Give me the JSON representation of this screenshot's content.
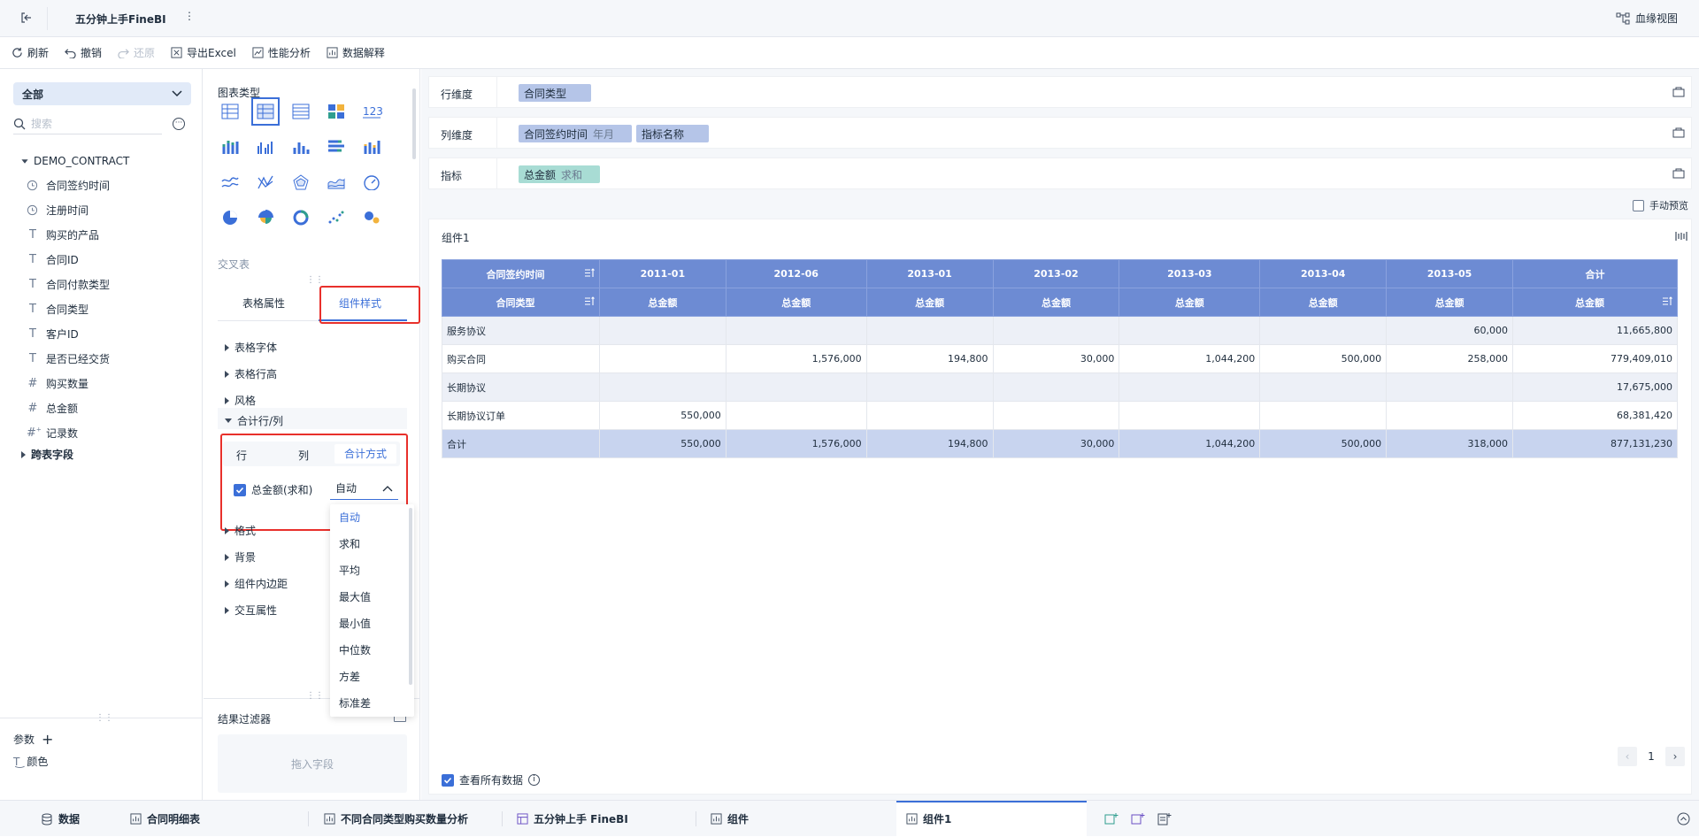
{
  "header": {
    "title": "五分钟上手FineBI",
    "lineage_view": "血缘视图"
  },
  "toolbar": {
    "refresh": "刷新",
    "undo": "撤销",
    "redo": "还原",
    "export_excel": "导出Excel",
    "perf_analysis": "性能分析",
    "data_explain": "数据解释"
  },
  "fields": {
    "scope_select": "全部",
    "search_placeholder": "搜索",
    "table_name": "DEMO_CONTRACT",
    "items": [
      {
        "type": "date",
        "label": "合同签约时间"
      },
      {
        "type": "date",
        "label": "注册时间"
      },
      {
        "type": "text",
        "label": "购买的产品"
      },
      {
        "type": "text",
        "label": "合同ID"
      },
      {
        "type": "text",
        "label": "合同付款类型"
      },
      {
        "type": "text",
        "label": "合同类型"
      },
      {
        "type": "text",
        "label": "客户ID"
      },
      {
        "type": "text",
        "label": "是否已经交货"
      },
      {
        "type": "number",
        "label": "购买数量"
      },
      {
        "type": "number",
        "label": "总金额"
      },
      {
        "type": "number-calc",
        "label": "记录数"
      }
    ],
    "cross_table_fields": "跨表字段",
    "params_label": "参数",
    "param_item": "颜色"
  },
  "config": {
    "chart_type_label": "图表类型",
    "chart_subtype": "交叉表",
    "tab_table_attr": "表格属性",
    "tab_component_style": "组件样式",
    "sections": [
      "表格字体",
      "表格行高",
      "风格"
    ],
    "total_section": "合计行/列",
    "total_tabs": [
      "行",
      "列",
      "合计方式"
    ],
    "total_checkbox_label": "总金额(求和)",
    "total_method_value": "自动",
    "sections_after": [
      "格式",
      "背景",
      "组件内边距",
      "交互属性"
    ],
    "dropdown_options": [
      "自动",
      "求和",
      "平均",
      "最大值",
      "最小值",
      "中位数",
      "方差",
      "标准差"
    ],
    "result_filter": "结果过滤器",
    "drag_field_placeholder": "拖入字段"
  },
  "main": {
    "row_dim_label": "行维度",
    "row_dim_pill": "合同类型",
    "col_dim_label": "列维度",
    "col_dim_pill1": "合同签约时间",
    "col_dim_pill1_sub": "年月",
    "col_dim_pill2": "指标名称",
    "metric_label": "指标",
    "metric_pill": "总金额",
    "metric_pill_sub": "求和",
    "manual_preview": "手动预览",
    "component_title": "组件1",
    "view_all_data": "查看所有数据",
    "page_number": "1"
  },
  "table": {
    "corner_top": "合同签约时间",
    "corner_bottom": "合同类型",
    "columns": [
      "2011-01",
      "2012-06",
      "2013-01",
      "2013-02",
      "2013-03",
      "2013-04",
      "2013-05",
      "合计"
    ],
    "measure": "总金额",
    "rows": [
      {
        "label": "服务协议",
        "values": [
          "",
          "",
          "",
          "",
          "",
          "",
          "60,000",
          "11,665,800"
        ]
      },
      {
        "label": "购买合同",
        "values": [
          "",
          "1,576,000",
          "194,800",
          "30,000",
          "1,044,200",
          "500,000",
          "258,000",
          "779,409,010"
        ]
      },
      {
        "label": "长期协议",
        "values": [
          "",
          "",
          "",
          "",
          "",
          "",
          "",
          "17,675,000"
        ]
      },
      {
        "label": "长期协议订单",
        "values": [
          "550,000",
          "",
          "",
          "",
          "",
          "",
          "",
          "68,381,420"
        ]
      }
    ],
    "total": {
      "label": "合计",
      "values": [
        "550,000",
        "1,576,000",
        "194,800",
        "30,000",
        "1,044,200",
        "500,000",
        "318,000",
        "877,131,230"
      ]
    }
  },
  "bottom_tabs": [
    "数据",
    "合同明细表",
    "不同合同类型购买数量分析",
    "五分钟上手 FineBI",
    "组件",
    "组件1"
  ]
}
